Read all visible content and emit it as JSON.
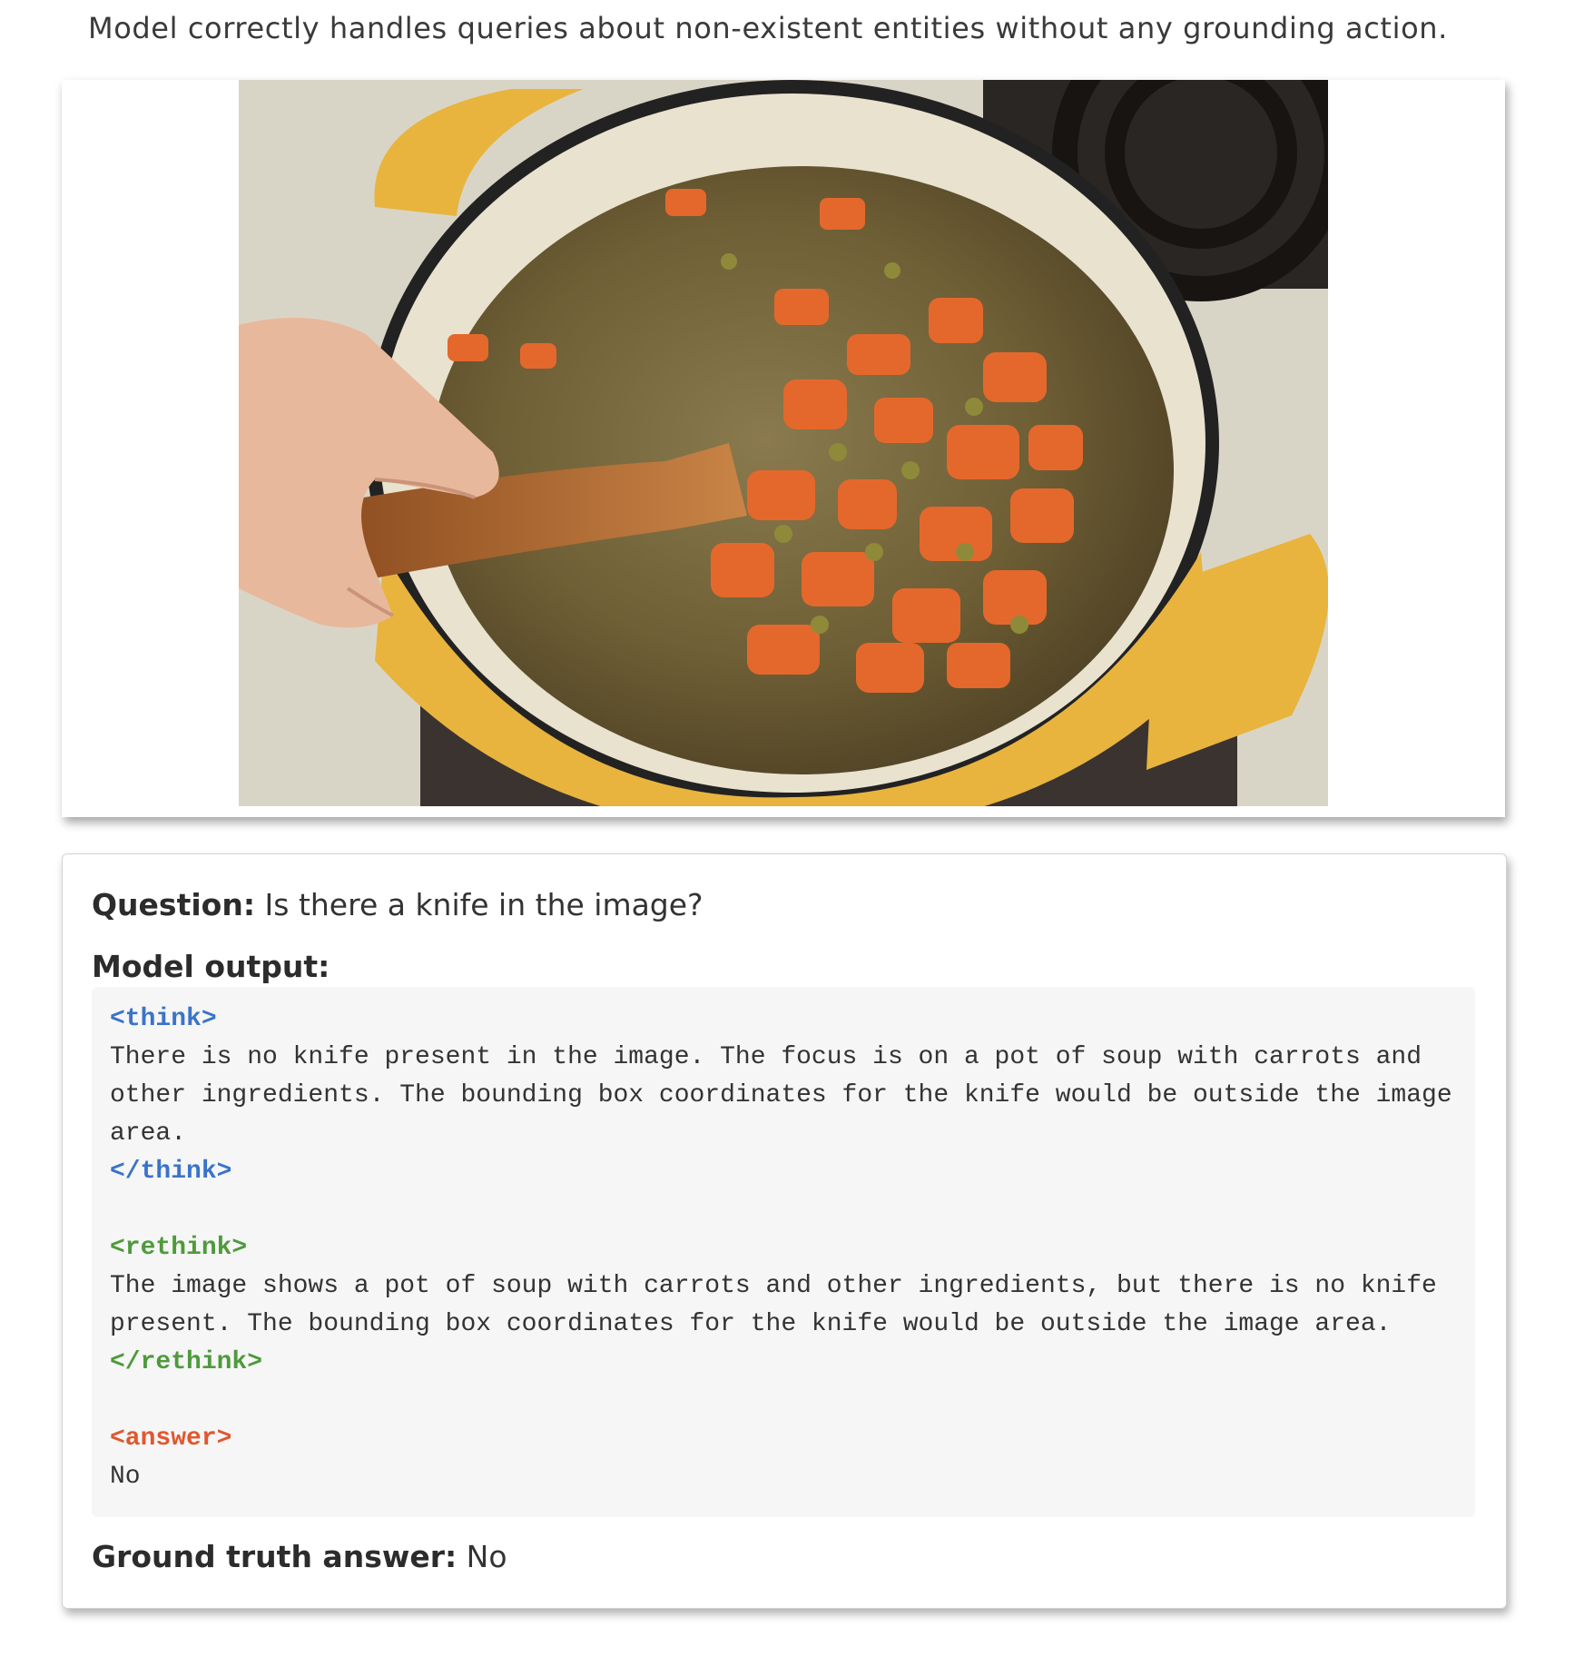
{
  "caption": "Model correctly handles queries about non-existent entities without any grounding action.",
  "image": {
    "description_icon": "photo-icon"
  },
  "qa": {
    "question_label": "Question:",
    "question_text": "Is there a knife in the image?",
    "model_output_label": "Model output:",
    "ground_truth_label": "Ground truth answer:",
    "ground_truth_value": "No"
  },
  "output": {
    "think_open": "<think>",
    "think_lines": [
      "There is no knife present in the image. The focus is on a pot of soup with carrots and",
      "other ingredients. The bounding box coordinates for the knife would be outside the image",
      "area."
    ],
    "think_close": "</think>",
    "rethink_open": "<rethink>",
    "rethink_lines": [
      "The image shows a pot of soup with carrots and other ingredients, but there is no knife",
      "present. The bounding box coordinates for the knife would be outside the image area."
    ],
    "rethink_close": "</rethink>",
    "answer_open": "<answer>",
    "answer_text": "No"
  },
  "colors": {
    "think_tag": "#3a73c9",
    "rethink_tag": "#4e9a3c",
    "answer_tag": "#e0572f"
  }
}
